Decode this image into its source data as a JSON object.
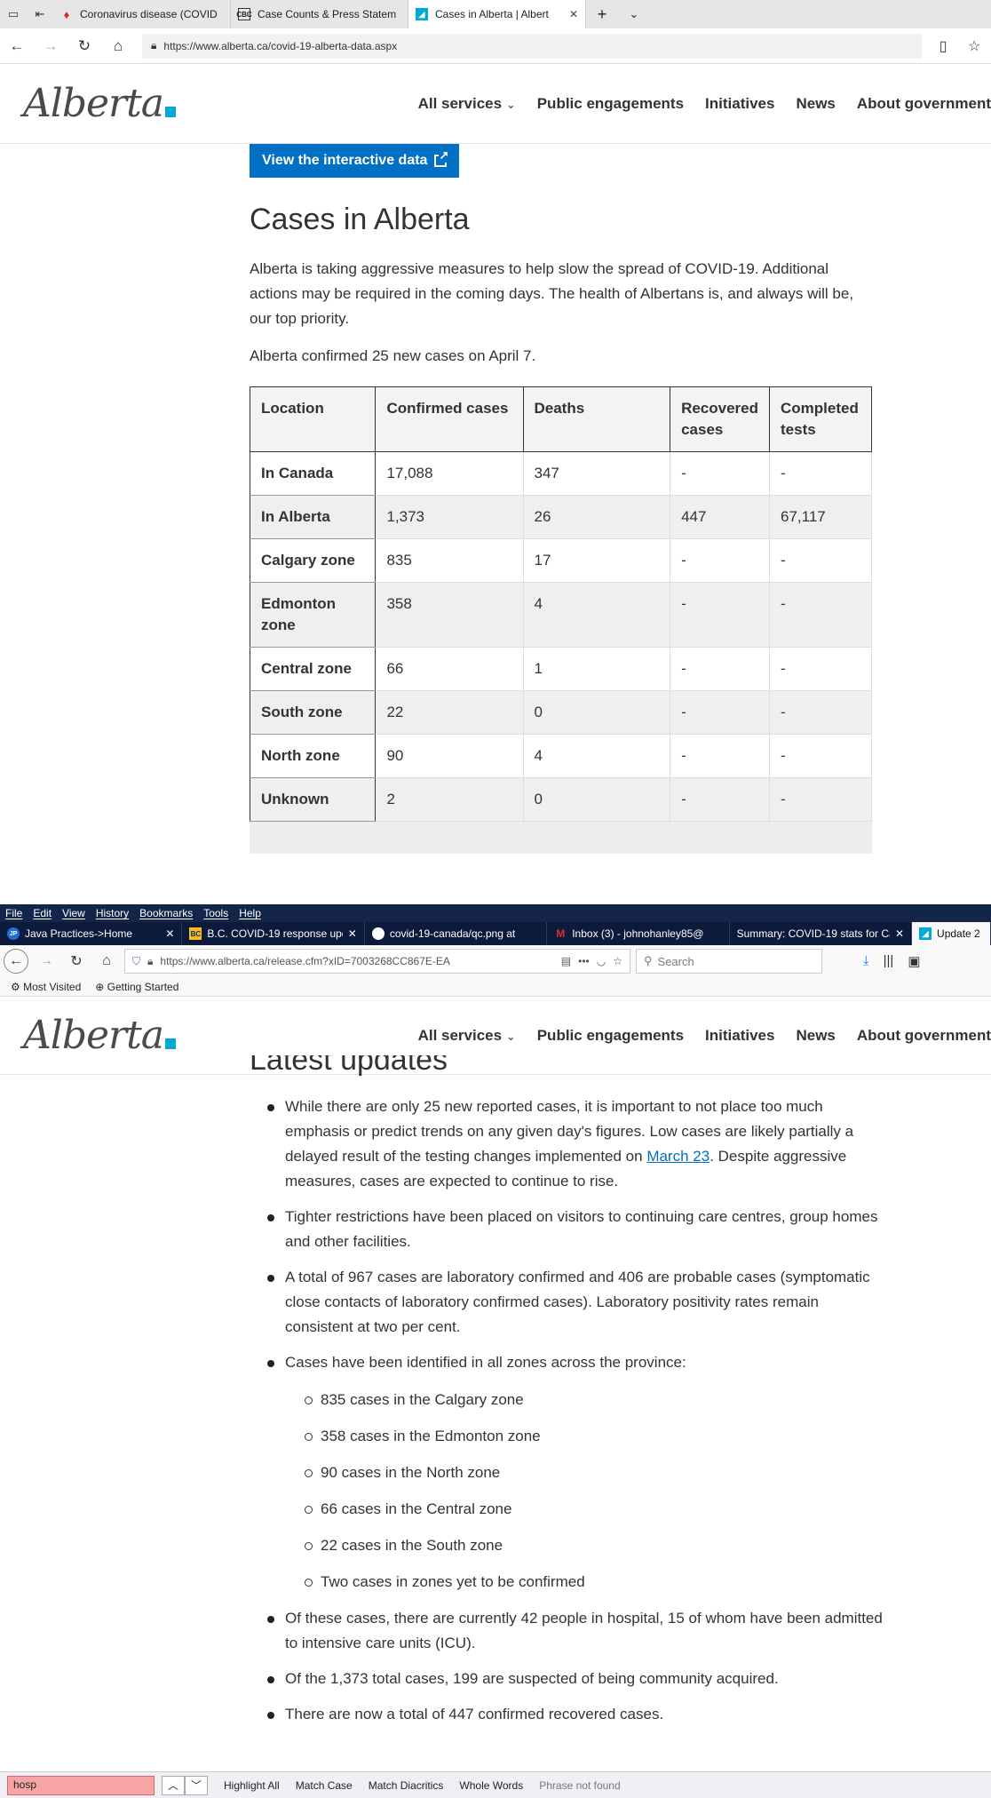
{
  "edge": {
    "tabs": [
      {
        "title": "Coronavirus disease (COVID",
        "favicon": "maple-leaf-icon"
      },
      {
        "title": "Case Counts & Press Statem",
        "favicon": "cbc-icon"
      },
      {
        "title": "Cases in Alberta | Albert",
        "favicon": "alberta-icon"
      }
    ],
    "url": "https://www.alberta.ca/covid-19-alberta-data.aspx"
  },
  "site": {
    "logo_text": "Alberta",
    "nav": {
      "all_services": "All services",
      "public_engagements": "Public engagements",
      "initiatives": "Initiatives",
      "news": "News",
      "about_government": "About government"
    },
    "accent_color": "#00aad2"
  },
  "page": {
    "interactive_button": "View the interactive data",
    "title": "Cases in Alberta",
    "lead": "Alberta is taking aggressive measures to help slow the spread of COVID-19. Additional actions may be required in the coming days. The health of Albertans is, and always will be, our top priority.",
    "confirmed_text": "Alberta confirmed 25 new cases on April 7.",
    "table": {
      "headers": [
        "Location",
        "Confirmed cases",
        "Deaths",
        "Recovered cases",
        "Completed tests"
      ],
      "rows": [
        [
          "In Canada",
          "17,088",
          "347",
          "-",
          "-"
        ],
        [
          "In Alberta",
          "1,373",
          "26",
          "447",
          "67,117"
        ],
        [
          "Calgary zone",
          "835",
          "17",
          "-",
          "-"
        ],
        [
          "Edmonton zone",
          "358",
          "4",
          "-",
          "-"
        ],
        [
          "Central zone",
          "66",
          "1",
          "-",
          "-"
        ],
        [
          "South zone",
          "22",
          "0",
          "-",
          "-"
        ],
        [
          "North zone",
          "90",
          "4",
          "-",
          "-"
        ],
        [
          "Unknown",
          "2",
          "0",
          "-",
          "-"
        ]
      ]
    }
  },
  "firefox": {
    "menu": [
      "File",
      "Edit",
      "View",
      "History",
      "Bookmarks",
      "Tools",
      "Help"
    ],
    "tabs": [
      {
        "title": "Java Practices->Home",
        "favicon": "jp-icon"
      },
      {
        "title": "B.C. COVID-19 response upd",
        "favicon": "bc-icon"
      },
      {
        "title": "covid-19-canada/qc.png at",
        "favicon": "github-icon"
      },
      {
        "title": "Inbox (3) - johnohanley85@",
        "favicon": "gmail-icon"
      },
      {
        "title": "Summary: COVID-19 stats for Ca",
        "favicon": "page-icon"
      },
      {
        "title": "Update 2",
        "favicon": "alberta-icon"
      }
    ],
    "url": "https://www.alberta.ca/release.cfm?xID=7003268CC867E-EA",
    "search_placeholder": "Search",
    "bookmarks": [
      "Most Visited",
      "Getting Started"
    ],
    "find": {
      "query": "hosp",
      "highlight_all": "Highlight All",
      "match_case": "Match Case",
      "match_diacritics": "Match Diacritics",
      "whole_words": "Whole Words",
      "status": "Phrase not found"
    }
  },
  "release": {
    "section_title": "Latest updates",
    "bullets": [
      {
        "before": "While there are only 25 new reported cases, it is important to not place too much emphasis or predict trends on any given day's figures. Low cases are likely partially a delayed result of the testing changes implemented on ",
        "link": "March 23",
        "after": ". Despite aggressive measures, cases are expected to continue to rise."
      },
      {
        "text": "Tighter restrictions have been placed on visitors to continuing care centres, group homes and other facilities."
      },
      {
        "text": "A total of 967 cases are laboratory confirmed and 406 are probable cases (symptomatic close contacts of laboratory confirmed cases). Laboratory positivity rates remain consistent at two per cent."
      },
      {
        "text": "Cases have been identified in all zones across the province:"
      },
      {
        "text": "Of these cases, there are currently 42 people in hospital, 15 of whom have been admitted to intensive care units (ICU)."
      },
      {
        "text": "Of the 1,373 total cases, 199 are suspected of being community acquired."
      },
      {
        "text": "There are now a total of 447 confirmed recovered cases."
      }
    ],
    "zones": [
      "835 cases in the Calgary zone",
      "358 cases in the Edmonton zone",
      "90 cases in the North zone",
      "66 cases in the Central zone",
      "22 cases in the South zone",
      "Two cases in zones yet to be confirmed"
    ]
  }
}
